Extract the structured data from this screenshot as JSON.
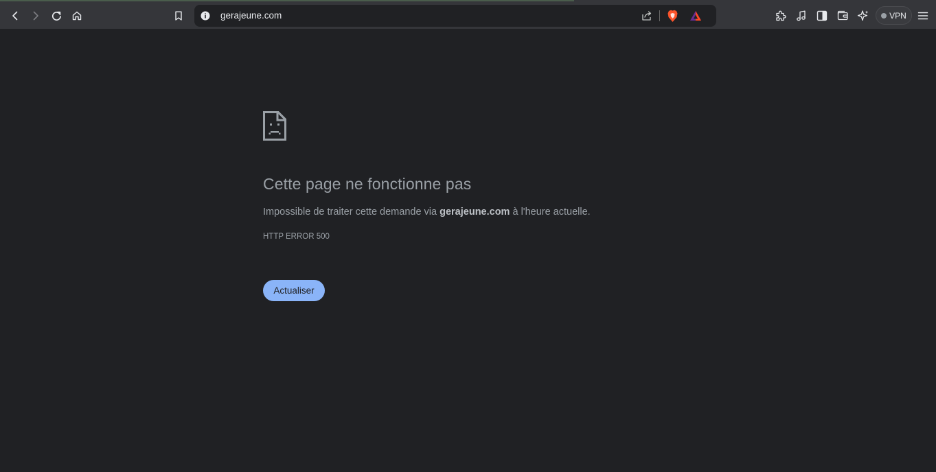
{
  "browser": {
    "address": {
      "url": "gerajeune.com"
    },
    "vpn_label": "VPN",
    "icons": {
      "back": "back-arrow-icon",
      "forward": "forward-arrow-icon",
      "reload": "reload-icon",
      "home": "home-icon",
      "bookmark": "bookmark-icon",
      "site_info": "info-icon",
      "share": "share-icon",
      "brave_shields": "brave-shields-icon",
      "brave_rewards": "brave-rewards-icon",
      "extensions": "puzzle-extensions-icon",
      "media": "music-note-icon",
      "sidebar": "sidebar-icon",
      "wallet": "wallet-icon",
      "leo": "leo-ai-sparkle-icon",
      "menu": "hamburger-menu-icon"
    }
  },
  "error_page": {
    "title": "Cette page ne fonctionne pas",
    "desc_prefix": "Impossible de traiter cette demande via ",
    "desc_domain": "gerajeune.com",
    "desc_suffix": " à l'heure actuelle.",
    "code": "HTTP ERROR 500",
    "reload_label": "Actualiser",
    "icon": "sad-page-icon"
  },
  "colors": {
    "page_bg": "#202124",
    "toolbar_bg": "#35363a",
    "text_muted": "#9aa0a6",
    "button_bg": "#8ab4f8"
  }
}
